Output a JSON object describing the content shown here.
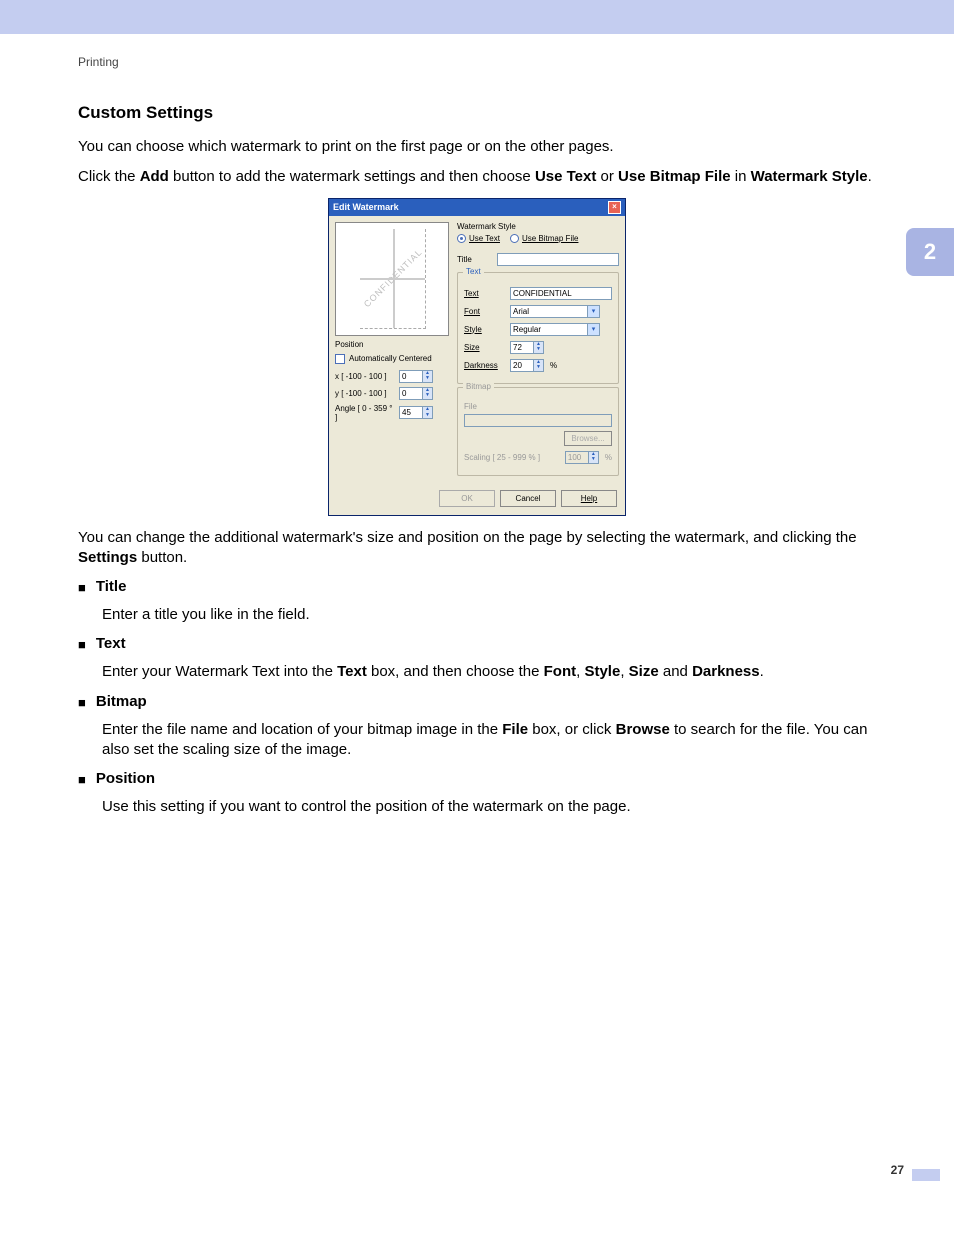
{
  "section_crumb": "Printing",
  "chapter_tab": "2",
  "page_number": "27",
  "heading": "Custom Settings",
  "para1": "You can choose which watermark to print on the first page or on the other pages.",
  "para2_pre": "Click the ",
  "para2_b1": "Add",
  "para2_mid1": " button to add the watermark settings and then choose ",
  "para2_b2": "Use Text",
  "para2_mid2": " or ",
  "para2_b3": "Use Bitmap File",
  "para2_mid3": " in ",
  "para2_b4": "Watermark Style",
  "para2_end": ".",
  "dialog": {
    "title": "Edit Watermark",
    "close": "×",
    "watermark_preview_text": "CONFIDENTIAL",
    "style_label": "Watermark Style",
    "use_text_label": "Use Text",
    "use_bitmap_label": "Use Bitmap File",
    "title_label": "Title",
    "title_value": "",
    "position_label": "Position",
    "auto_center_label": "Automatically Centered",
    "pos_x_label": "x [ -100 - 100 ]",
    "pos_x_value": "0",
    "pos_y_label": "y [ -100 - 100 ]",
    "pos_y_value": "0",
    "angle_label": "Angle [ 0 - 359 ° ]",
    "angle_value": "45",
    "text_group": "Text",
    "text_label": "Text",
    "text_value": "CONFIDENTIAL",
    "font_label": "Font",
    "font_value": "Arial",
    "style_field_label": "Style",
    "style_value": "Regular",
    "size_label": "Size",
    "size_value": "72",
    "darkness_label": "Darkness",
    "darkness_value": "20",
    "darkness_unit": "%",
    "bitmap_group": "Bitmap",
    "file_label": "File",
    "file_value": "",
    "browse_label": "Browse...",
    "scaling_label": "Scaling [ 25 - 999 % ]",
    "scaling_value": "100",
    "scaling_unit": "%",
    "ok": "OK",
    "cancel": "Cancel",
    "help": "Help"
  },
  "para3_pre": "You can change the additional watermark's size and position on the page by selecting the watermark, and clicking the ",
  "para3_b": "Settings",
  "para3_end": " button.",
  "items": {
    "title": {
      "head": "Title",
      "body": "Enter a title you like in the field."
    },
    "text": {
      "head": "Text",
      "body_pre": "Enter your Watermark Text into the ",
      "b1": "Text",
      "mid1": " box, and then choose the ",
      "b2": "Font",
      "mid2": ", ",
      "b3": "Style",
      "mid3": ", ",
      "b4": "Size",
      "mid4": " and ",
      "b5": "Darkness",
      "end": "."
    },
    "bitmap": {
      "head": "Bitmap",
      "body_pre": "Enter the file name and location of your bitmap image in the ",
      "b1": "File",
      "mid1": " box, or click ",
      "b2": "Browse",
      "end": " to search for the file. You can also set the scaling size of the image."
    },
    "position": {
      "head": "Position",
      "body": "Use this setting if you want to control the position of the watermark on the page."
    }
  }
}
